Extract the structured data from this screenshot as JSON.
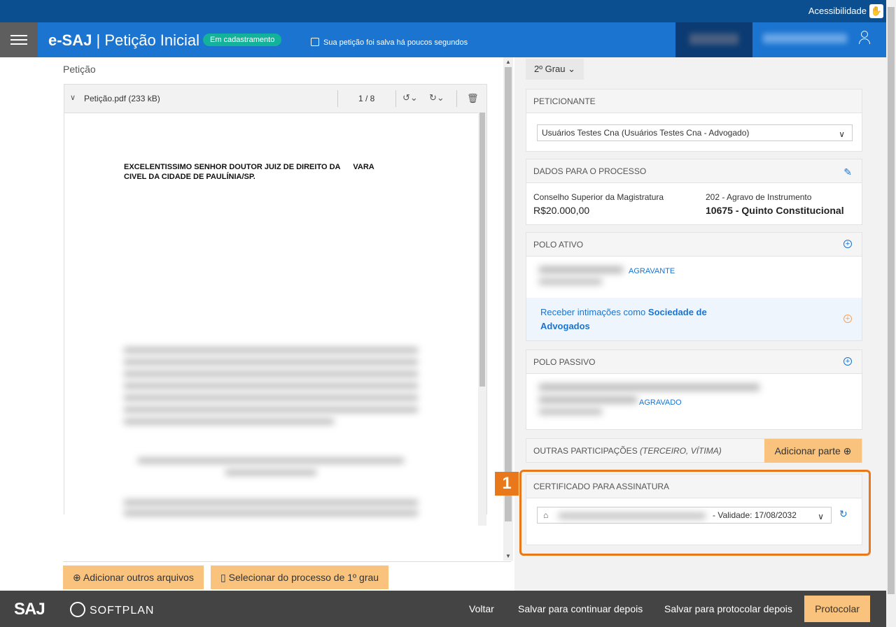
{
  "topbar": {
    "accessibility_label": "Acessibilidade"
  },
  "header": {
    "brand": "e-SAJ",
    "title": "Petição Inicial",
    "status_badge": "Em cadastramento",
    "saved_message": "Sua petição foi salva há poucos segundos"
  },
  "left": {
    "section_label": "Petição",
    "viewer": {
      "file_name": "Petição.pdf (233 kB)",
      "page_indicator": "1 / 8",
      "doc_heading": "EXCELENTISSIMO SENHOR DOUTOR JUIZ DE DIREITO DA      VARA\nCIVEL DA CIDADE DE PAULÍNIA/SP."
    },
    "buttons": {
      "add_files": "Adicionar outros arquivos",
      "select_first_degree": "Selecionar do processo de 1º grau"
    }
  },
  "right": {
    "grau": "2º Grau",
    "peticionante": {
      "title": "PETICIONANTE",
      "selected": "Usuários Testes Cna (Usuários Testes Cna - Advogado)"
    },
    "dados": {
      "title": "DADOS PARA O PROCESSO",
      "col1_label": "Conselho Superior da Magistratura",
      "col1_value": "R$20.000,00",
      "col2_label": "202 - Agravo de Instrumento",
      "col2_value": "10675 - Quinto Constitucional"
    },
    "polo_ativo": {
      "title": "POLO ATIVO",
      "role": "AGRAVANTE",
      "intimacoes_prefix": "Receber intimações como ",
      "intimacoes_bold": "Sociedade de Advogados"
    },
    "polo_passivo": {
      "title": "POLO PASSIVO",
      "role": "AGRAVADO"
    },
    "outras": {
      "title": "OUTRAS PARTICIPAÇÕES",
      "title_italic": "(TERCEIRO, VÍTIMA)",
      "add_button": "Adicionar parte"
    },
    "certificado": {
      "title": "CERTIFICADO PARA ASSINATURA",
      "validity": "- Validade: 17/08/2032",
      "callout_number": "1"
    }
  },
  "footer": {
    "softplan": "SOFTPLAN",
    "saj": "SAJ",
    "voltar": "Voltar",
    "salvar_continuar": "Salvar para continuar depois",
    "salvar_protocolar": "Salvar para protocolar depois",
    "protocolar": "Protocolar"
  },
  "colors": {
    "header_blue": "#1a74d0",
    "topbar_blue": "#0b4f91",
    "accent_orange": "#f9c27d",
    "highlight_orange": "#e8781a",
    "badge_green": "#12b39a"
  }
}
